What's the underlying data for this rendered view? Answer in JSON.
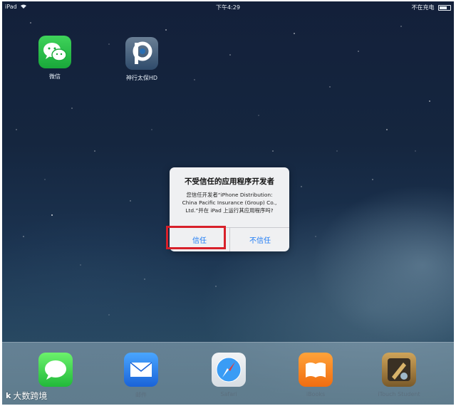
{
  "status_bar": {
    "device": "iPad",
    "time": "下午4:29",
    "charging_status": "不在充电"
  },
  "home_apps": [
    {
      "label": "微信",
      "icon": "wechat-icon"
    },
    {
      "label": "神行太保HD",
      "icon": "cpic-p-logo-icon"
    }
  ],
  "alert": {
    "title": "不受信任的应用程序开发者",
    "message_line1": "您信任开发者“iPhone Distribution:",
    "message_line2": "China Pacific Insurance (Group) Co.,",
    "message_line3": "Ltd.”并在 iPad 上运行其应用程序吗?",
    "trust_button": "信任",
    "distrust_button": "不信任",
    "highlight_color": "#d8202a",
    "button_color": "#1e7cf5"
  },
  "dock_apps": [
    {
      "label": "",
      "icon": "messages-icon"
    },
    {
      "label": "邮件",
      "icon": "mail-icon"
    },
    {
      "label": "Safari",
      "icon": "safari-compass-icon"
    },
    {
      "label": "iBooks",
      "icon": "ibooks-icon"
    },
    {
      "label": "iTouch Student",
      "icon": "itouch-student-icon"
    }
  ],
  "watermark": {
    "logo": "k",
    "text": "大数跨境"
  }
}
